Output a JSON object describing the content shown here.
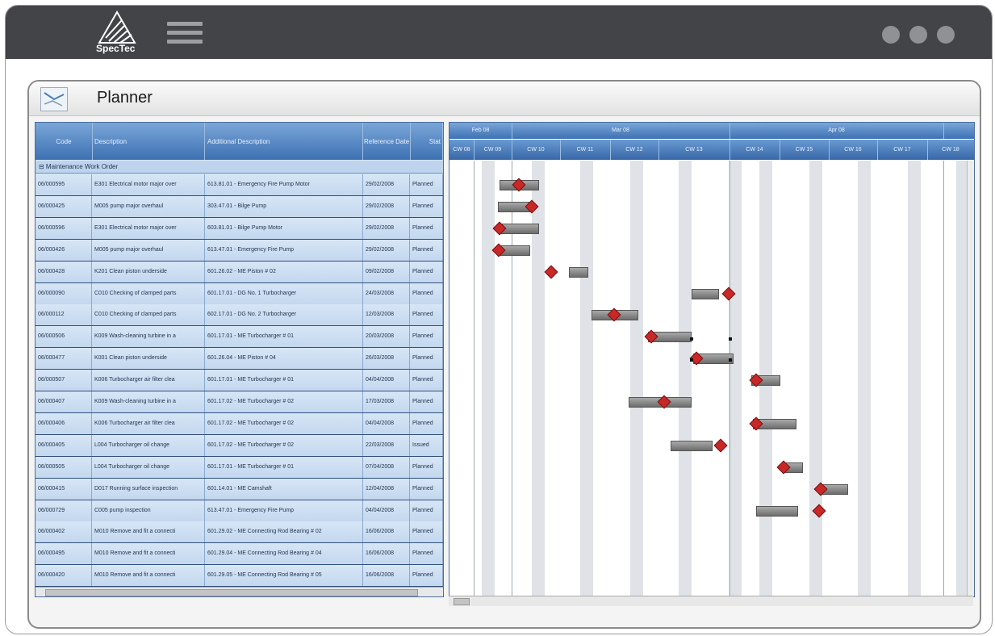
{
  "app": {
    "logo_text": "SpecTec",
    "title": "Planner"
  },
  "grid": {
    "columns": [
      "Code",
      "Description",
      "Additional Description",
      "Reference Date",
      "Stat"
    ],
    "group_label": "⊟ Maintenance Work Order",
    "rows": [
      {
        "code": "06/000595",
        "desc": "E301 Electrical motor major over",
        "add": "613.81.01 - Emergency Fire Pump Motor",
        "date": "29/02/2008",
        "status": "Planned"
      },
      {
        "code": "06/000425",
        "desc": "M005 pump major overhaul",
        "add": "303.47.01 - Bilge Pump",
        "date": "29/02/2008",
        "status": "Planned"
      },
      {
        "code": "06/000596",
        "desc": "E301 Electrical motor major over",
        "add": "603.81.01 - Bilge Pump Motor",
        "date": "29/02/2008",
        "status": "Planned"
      },
      {
        "code": "06/000426",
        "desc": "M005 pump major overhaul",
        "add": "613.47.01 - Emergency Fire Pump",
        "date": "29/02/2008",
        "status": "Planned"
      },
      {
        "code": "06/000428",
        "desc": "K201 Clean piston underside",
        "add": "601.26.02 - ME Piston # 02",
        "date": "09/02/2008",
        "status": "Planned"
      },
      {
        "code": "06/000090",
        "desc": "C010 Checking of clamped parts",
        "add": "601.17.01 - DG No. 1 Turbocharger",
        "date": "24/03/2008",
        "status": "Planned"
      },
      {
        "code": "06/000112",
        "desc": "C010 Checking of clamped parts",
        "add": "602.17.01 - DG No. 2 Turbocharger",
        "date": "12/03/2008",
        "status": "Planned"
      },
      {
        "code": "06/000506",
        "desc": "K009 Wash-cleaning turbine in a",
        "add": "601.17.01 - ME Turbocharger # 01",
        "date": "20/03/2008",
        "status": "Planned"
      },
      {
        "code": "06/000477",
        "desc": "K001 Clean piston underside",
        "add": "601.26.04 - ME Piston # 04",
        "date": "26/03/2008",
        "status": "Planned"
      },
      {
        "code": "06/000507",
        "desc": "K006 Turbocharger air filter clea",
        "add": "601.17.01 - ME Turbocharger # 01",
        "date": "04/04/2008",
        "status": "Planned"
      },
      {
        "code": "06/000407",
        "desc": "K009 Wash-cleaning turbine in a",
        "add": "601.17.02 - ME Turbocharger # 02",
        "date": "17/03/2008",
        "status": "Planned"
      },
      {
        "code": "06/000406",
        "desc": "K006 Turbocharger air filter clea",
        "add": "601.17.02 - ME Turbocharger # 02",
        "date": "04/04/2008",
        "status": "Planned"
      },
      {
        "code": "06/000405",
        "desc": "L004 Turbocharger oil change",
        "add": "601.17.02 - ME Turbocharger # 02",
        "date": "22/03/2008",
        "status": "Issued"
      },
      {
        "code": "06/000505",
        "desc": "L004 Turbocharger oil change",
        "add": "601.17.01 - ME Turbocharger # 01",
        "date": "07/04/2008",
        "status": "Planned"
      },
      {
        "code": "06/000415",
        "desc": "D017 Running surface inspection",
        "add": "601.14.01 - ME Camshaft",
        "date": "12/04/2008",
        "status": "Planned"
      },
      {
        "code": "06/000729",
        "desc": "C005 pump inspection",
        "add": "613.47.01 - Emergency Fire Pump",
        "date": "04/04/2008",
        "status": "Planned"
      },
      {
        "code": "06/000402",
        "desc": "M010 Remove and fit a connecti",
        "add": "601.29.02 - ME Connecting Rod Bearing # 02",
        "date": "16/06/2008",
        "status": "Planned"
      },
      {
        "code": "06/000495",
        "desc": "M010 Remove and fit a connecti",
        "add": "601.29.04 - ME Connecting Rod Bearing # 04",
        "date": "16/06/2008",
        "status": "Planned"
      },
      {
        "code": "06/000420",
        "desc": "M010 Remove and fit a connecti",
        "add": "601.29.05 - ME Connecting Rod Bearing # 05",
        "date": "16/06/2008",
        "status": "Planned"
      }
    ]
  },
  "gantt": {
    "months": [
      "Feb 08",
      "Mar 08",
      "Apr 08"
    ],
    "weeks": [
      "CW 08",
      "CW 09",
      "CW 10",
      "CW 11",
      "CW 12",
      "CW 13",
      "CW 14",
      "CW 15",
      "CW 16",
      "CW 17",
      "CW 18"
    ]
  },
  "colors": {
    "topbar": "#424448",
    "header_blue": "#3d71b3",
    "milestone": "#c82828"
  }
}
